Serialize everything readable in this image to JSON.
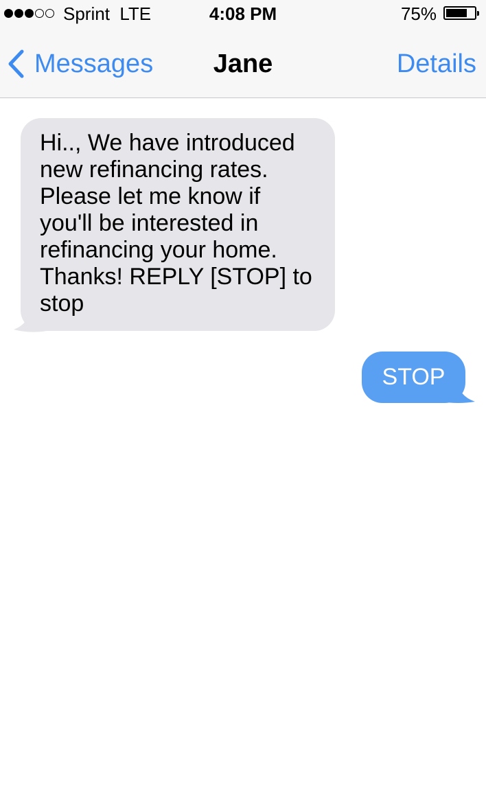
{
  "status_bar": {
    "carrier": "Sprint  LTE",
    "time": "4:08 PM",
    "battery_percent": "75%",
    "battery_level": 0.75,
    "signal_bars": 3,
    "signal_total": 5
  },
  "nav": {
    "back_label": "Messages",
    "title": "Jane",
    "details_label": "Details",
    "accent_color": "#3d8bf0"
  },
  "messages": [
    {
      "direction": "incoming",
      "text": "Hi.., We have introduced new refinancing rates. Please let me know if you'll be interested in refinancing your home. Thanks! REPLY [STOP] to stop",
      "color": "#e5e5ea"
    },
    {
      "direction": "outgoing",
      "text": "STOP",
      "color": "#5aa0f2"
    }
  ]
}
